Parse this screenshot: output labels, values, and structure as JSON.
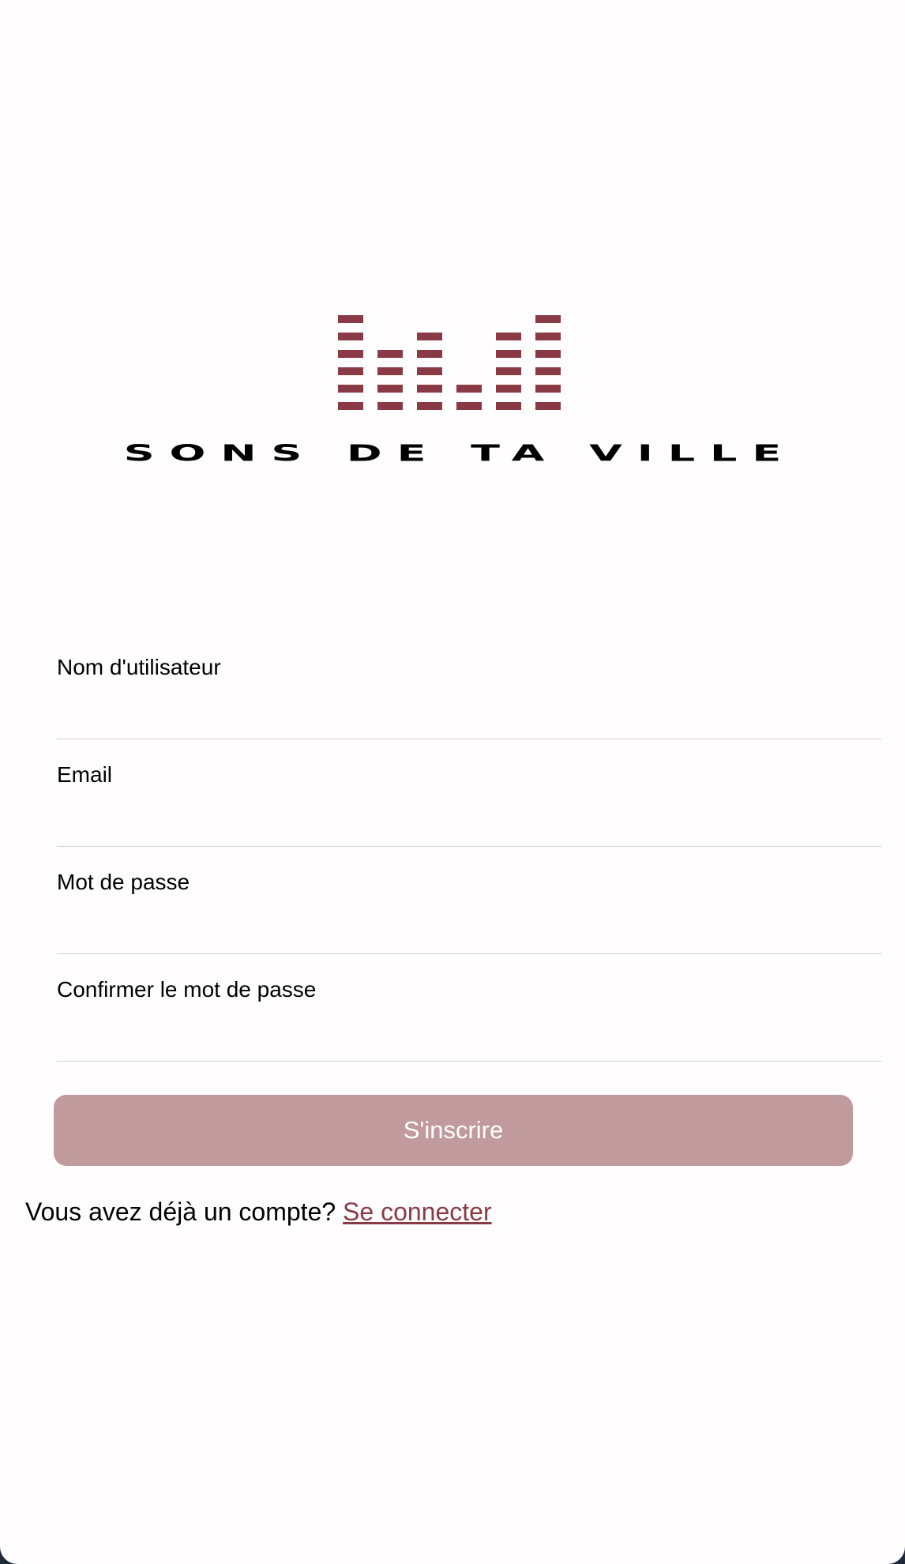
{
  "brand": {
    "name": "SONS DE TA VILLE",
    "accent_color": "#8a3a44",
    "logo_icon": "equalizer-bars-icon"
  },
  "form": {
    "fields": [
      {
        "label": "Nom d'utilisateur",
        "value": ""
      },
      {
        "label": "Email",
        "value": ""
      },
      {
        "label": "Mot de passe",
        "value": ""
      },
      {
        "label": "Confirmer le mot de passe",
        "value": ""
      }
    ],
    "submit_label": "S'inscrire",
    "submit_color": "#c19a9d"
  },
  "footer": {
    "prompt": "Vous avez déjà un compte?",
    "link_label": "Se connecter"
  }
}
